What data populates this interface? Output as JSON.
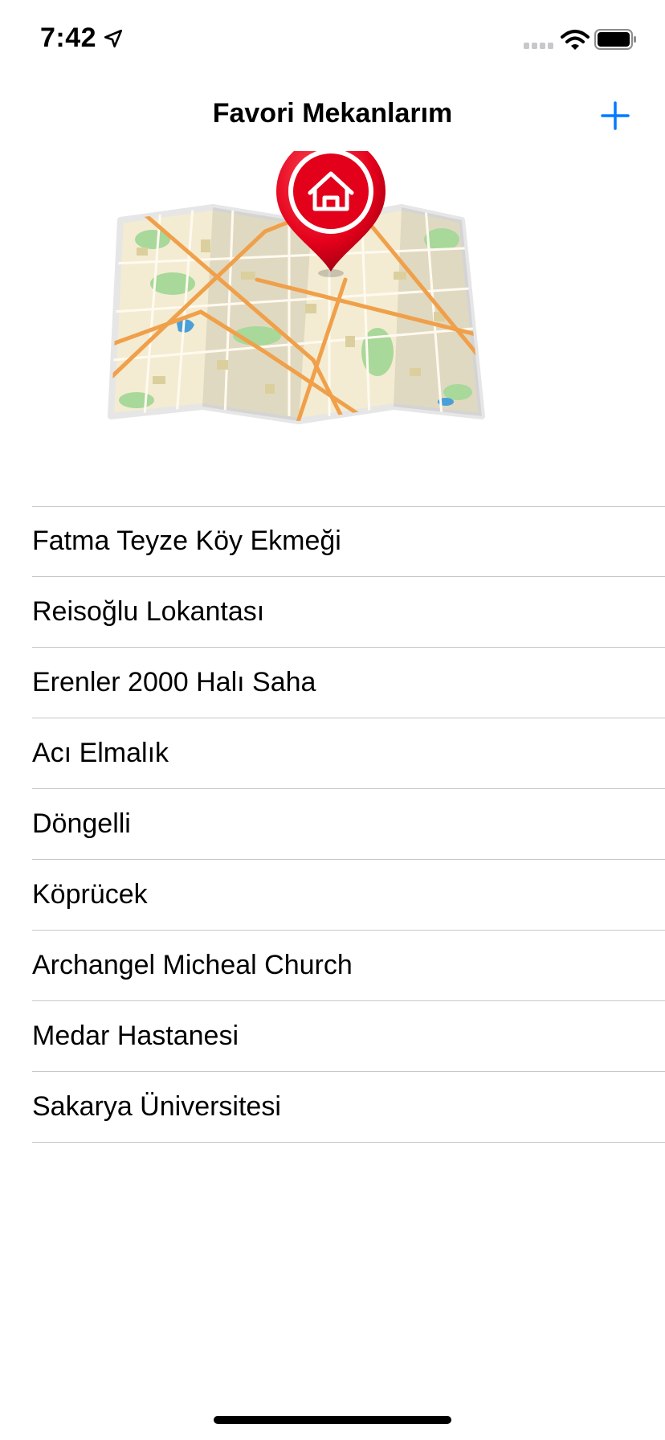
{
  "status_bar": {
    "time": "7:42",
    "icons": [
      "location-arrow-icon",
      "signal-icon",
      "wifi-icon",
      "battery-icon"
    ]
  },
  "nav": {
    "title": "Favori Mekanlarım",
    "add_icon": "plus-icon"
  },
  "header_image": {
    "description_icon": "map-with-home-pin",
    "accent_color": "#e3001b"
  },
  "places": [
    {
      "label": "Fatma Teyze Köy Ekmeği"
    },
    {
      "label": "Reisoğlu Lokantası"
    },
    {
      "label": "Erenler 2000 Halı Saha"
    },
    {
      "label": "Acı Elmalık"
    },
    {
      "label": "Döngelli"
    },
    {
      "label": "Köprücek"
    },
    {
      "label": "Archangel Micheal Church"
    },
    {
      "label": "Medar Hastanesi"
    },
    {
      "label": "Sakarya Üniversitesi"
    }
  ],
  "colors": {
    "tint": "#007aff",
    "separator": "#c6c6c8"
  }
}
